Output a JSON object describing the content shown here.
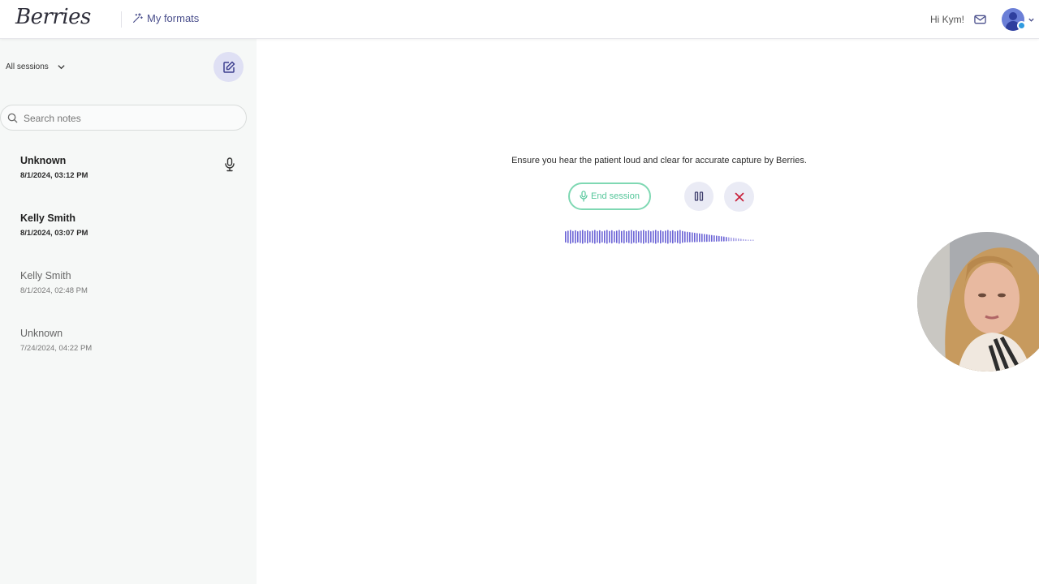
{
  "header": {
    "logo": "Berries",
    "formats_label": "My formats",
    "greeting": "Hi Kym!"
  },
  "sidebar": {
    "filter_label": "All sessions",
    "search_placeholder": "Search notes",
    "sessions": [
      {
        "name": "Unknown",
        "date": "8/1/2024, 03:12 PM",
        "style": "bold",
        "recording": true
      },
      {
        "name": "Kelly Smith",
        "date": "8/1/2024, 03:07 PM",
        "style": "bold",
        "recording": false
      },
      {
        "name": "Kelly Smith",
        "date": "8/1/2024, 02:48 PM",
        "style": "muted",
        "recording": false
      },
      {
        "name": "Unknown",
        "date": "7/24/2024, 04:22 PM",
        "style": "muted",
        "recording": false
      }
    ]
  },
  "recording": {
    "instruction": "Ensure you hear the patient loud and clear for accurate capture by Berries.",
    "end_label": "End session"
  },
  "colors": {
    "accent": "#4a4f8c",
    "end_session_green": "#54c69a",
    "cancel_red": "#c8203a",
    "waveform": "#6b63d6",
    "sidebar_bg": "#f6f8f7"
  },
  "icons": [
    "magic-wand-icon",
    "mail-icon",
    "user-avatar-icon",
    "chevron-down-icon",
    "edit-icon",
    "search-icon",
    "microphone-icon",
    "pause-icon",
    "close-icon"
  ]
}
